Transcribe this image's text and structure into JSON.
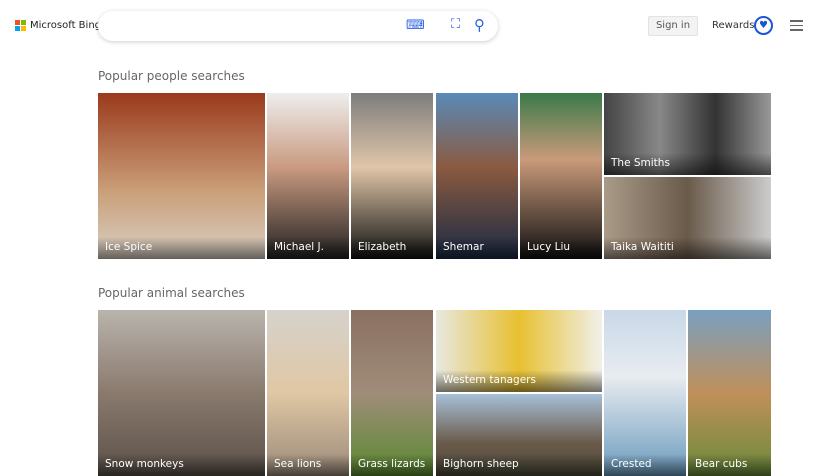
{
  "header": {
    "brand": "Microsoft Bing",
    "search_placeholder": "",
    "sign_in": "Sign in",
    "rewards": "Rewards",
    "icons": [
      "keyboard-icon",
      "visual-search-icon",
      "search-icon",
      "rewards-medal-icon",
      "hamburger-menu-icon"
    ]
  },
  "people": {
    "title": "Popular people searches",
    "items": [
      "Ice Spice",
      "Michael J. Fox",
      "Elizabeth",
      "Shemar Moore",
      "Lucy Liu",
      "The Smiths",
      "Taika Waititi"
    ]
  },
  "animals": {
    "title": "Popular animal searches",
    "items": [
      "Snow monkeys",
      "Sea lions",
      "Grass lizards",
      "Western tanagers",
      "Bighorn sheep",
      "Crested couas",
      "Bear cubs"
    ]
  }
}
